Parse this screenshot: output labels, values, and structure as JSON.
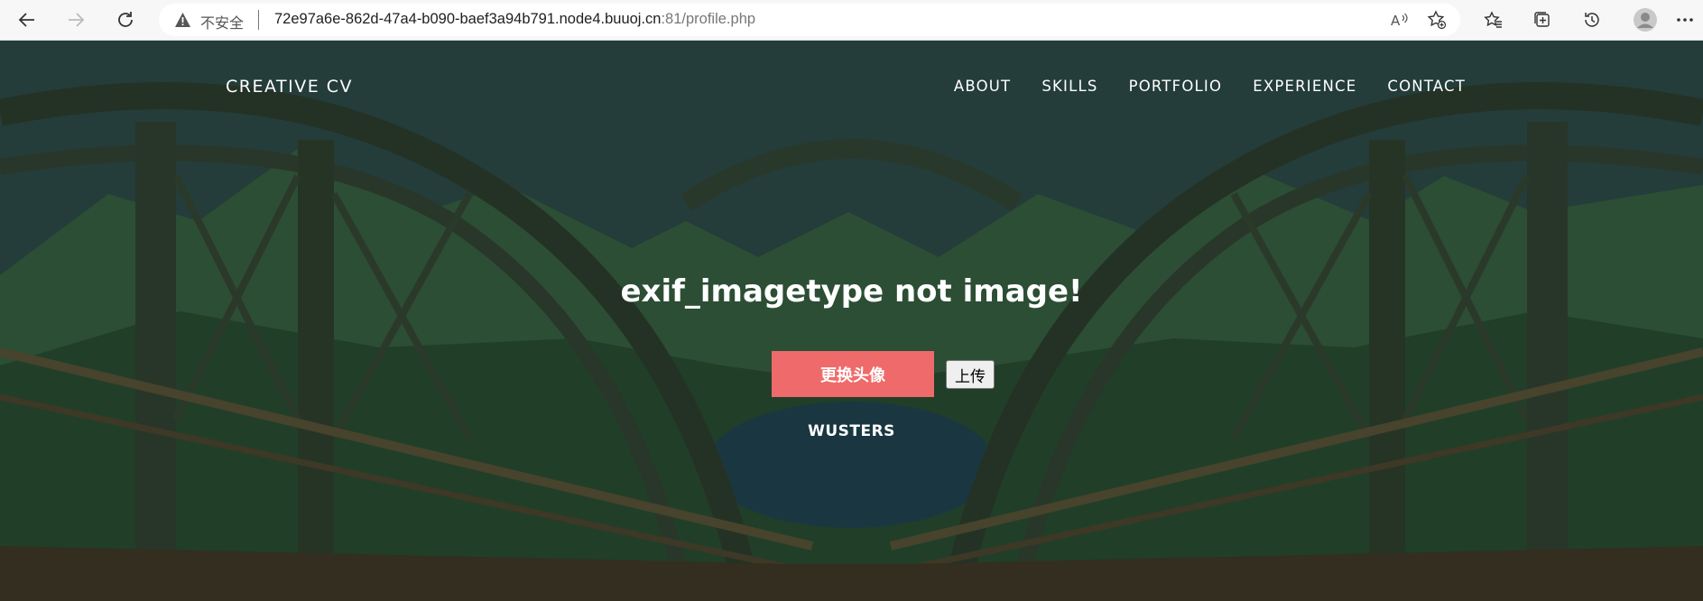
{
  "browser": {
    "security_label": "不安全",
    "url_host": "72e97a6e-862d-47a4-b090-baef3a94b791.node4.buuoj.cn",
    "url_rest": ":81/profile.php"
  },
  "site": {
    "brand": "CREATIVE CV",
    "nav": [
      "ABOUT",
      "SKILLS",
      "PORTFOLIO",
      "EXPERIENCE",
      "CONTACT"
    ]
  },
  "main": {
    "message": "exif_imagetype not image!",
    "change_avatar_label": "更换头像",
    "upload_label": "上传",
    "username": "WUSTERS"
  },
  "colors": {
    "accent_button": "#ef6a6a",
    "text": "#ffffff"
  }
}
